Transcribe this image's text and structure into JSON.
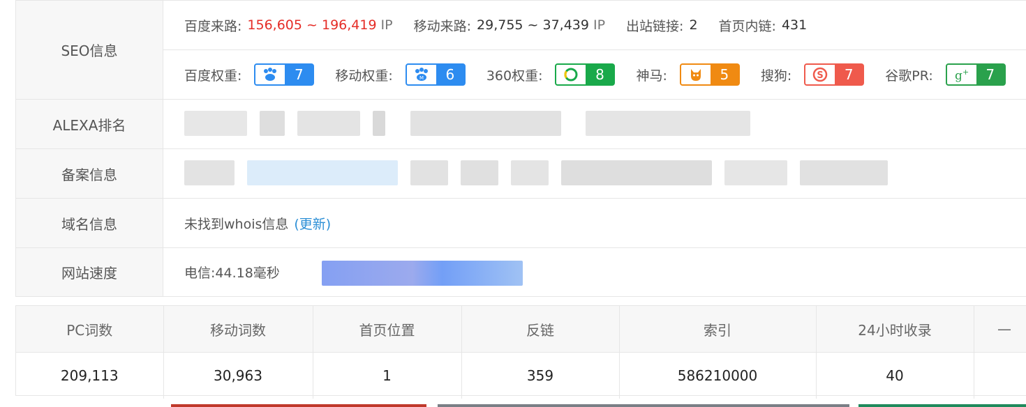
{
  "seo": {
    "label": "SEO信息",
    "baidu_traffic_label": "百度来路:",
    "baidu_traffic_value": "156,605 ~ 196,419",
    "mobile_traffic_label": "移动来路:",
    "mobile_traffic_value": "29,755 ~ 37,439",
    "ip_unit": "IP",
    "outbound_label": "出站链接:",
    "outbound_value": "2",
    "home_internal_label": "首页内链:",
    "home_internal_value": "431",
    "weights": [
      {
        "label": "百度权重:",
        "value": "7",
        "color": "#2d8cf0",
        "icon": "baidu-paw-icon"
      },
      {
        "label": "移动权重:",
        "value": "6",
        "color": "#2d8cf0",
        "icon": "baidu-mobile-paw-icon"
      },
      {
        "label": "360权重:",
        "value": "8",
        "color": "#19a94a",
        "icon": "360-search-icon"
      },
      {
        "label": "神马:",
        "value": "5",
        "color": "#f08a12",
        "icon": "shenma-horse-icon"
      },
      {
        "label": "搜狗:",
        "value": "7",
        "color": "#ef5a4c",
        "icon": "sogou-s-icon"
      },
      {
        "label": "谷歌PR:",
        "value": "7",
        "color": "#2aa14c",
        "icon": "google-plus-icon"
      }
    ]
  },
  "alexa": {
    "label": "ALEXA排名"
  },
  "icp": {
    "label": "备案信息"
  },
  "domain": {
    "label": "域名信息",
    "text": "未找到whois信息",
    "update_link": "(更新)"
  },
  "speed": {
    "label": "网站速度",
    "text": "电信:44.18毫秒"
  },
  "stats": {
    "headers": [
      "PC词数",
      "移动词数",
      "首页位置",
      "反链",
      "索引",
      "24小时收录",
      "—"
    ],
    "values": [
      "209,113",
      "30,963",
      "1",
      "359",
      "586210000",
      "40",
      ""
    ]
  },
  "colors": {
    "accent_red": "#e52d27",
    "link_blue": "#2c8fd6",
    "border": "#e6e6e6",
    "label_bg": "#f7f7f7"
  }
}
